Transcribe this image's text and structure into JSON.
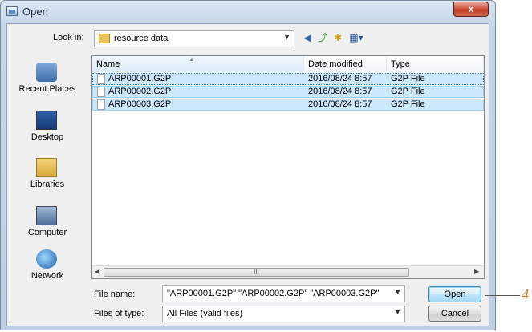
{
  "window": {
    "title": "Open",
    "close_label": "x"
  },
  "lookin": {
    "label": "Look in:",
    "value": "resource data"
  },
  "places": [
    {
      "label": "Recent Places"
    },
    {
      "label": "Desktop"
    },
    {
      "label": "Libraries"
    },
    {
      "label": "Computer"
    },
    {
      "label": "Network"
    }
  ],
  "columns": {
    "name": "Name",
    "date": "Date modified",
    "type": "Type"
  },
  "files": [
    {
      "name": "ARP00001.G2P",
      "date": "2016/08/24 8:57",
      "type": "G2P File"
    },
    {
      "name": "ARP00002.G2P",
      "date": "2016/08/24 8:57",
      "type": "G2P File"
    },
    {
      "name": "ARP00003.G2P",
      "date": "2016/08/24 8:57",
      "type": "G2P File"
    }
  ],
  "scrollbar": {
    "grip": "III"
  },
  "filename": {
    "label": "File name:",
    "value": "\"ARP00001.G2P\" \"ARP00002.G2P\" \"ARP00003.G2P\""
  },
  "filetype": {
    "label": "Files of type:",
    "value": "All Files (valid files)"
  },
  "buttons": {
    "open": "Open",
    "cancel": "Cancel"
  },
  "callout": "4",
  "colors": {
    "selection": "#cce8ff",
    "accent": "#d97a1e"
  }
}
